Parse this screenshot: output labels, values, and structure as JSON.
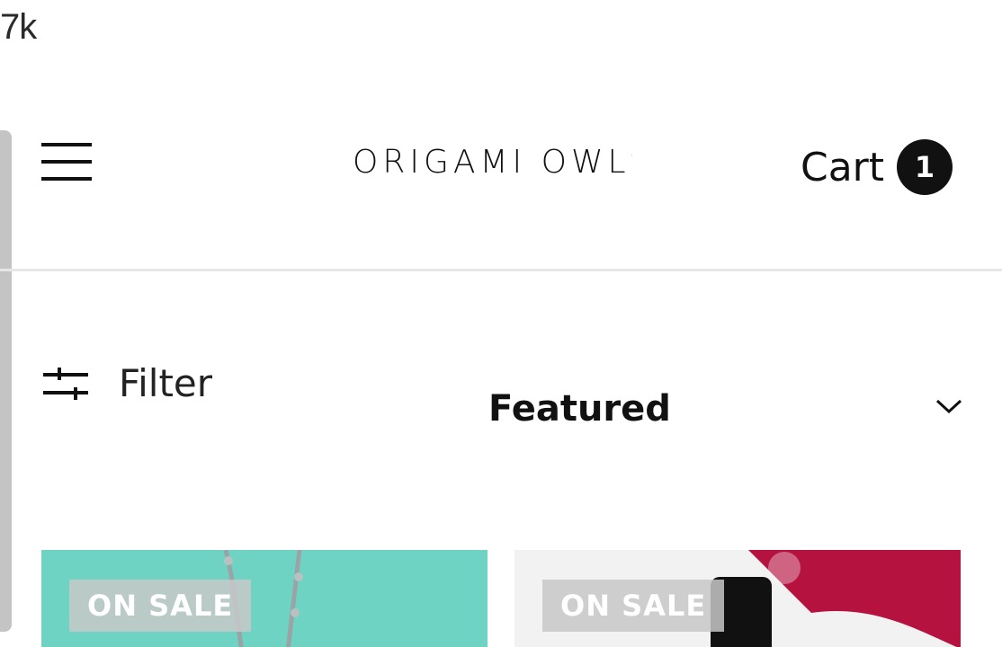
{
  "overlay": {
    "text": "7k"
  },
  "header": {
    "logo_text": "ORIGAMI OWL",
    "logo_mark": "·",
    "cart_label": "Cart",
    "cart_count": "1"
  },
  "toolbar": {
    "filter_label": "Filter",
    "sort_selected": "Featured"
  },
  "products": [
    {
      "badge": "ON SALE",
      "image": "silver-chain-necklace-on-teal"
    },
    {
      "badge": "ON SALE",
      "image": "black-charm-ring-with-red-flowers"
    }
  ],
  "icons": {
    "menu": "hamburger-icon",
    "filter": "sliders-icon",
    "sort": "chevron-down-icon"
  },
  "colors": {
    "accent": "#111111",
    "product_1_bg": "#6fd3c3",
    "product_2_bg": "#ececec",
    "sale_badge": "#c8c8c8",
    "divider": "#e6e6e6"
  }
}
